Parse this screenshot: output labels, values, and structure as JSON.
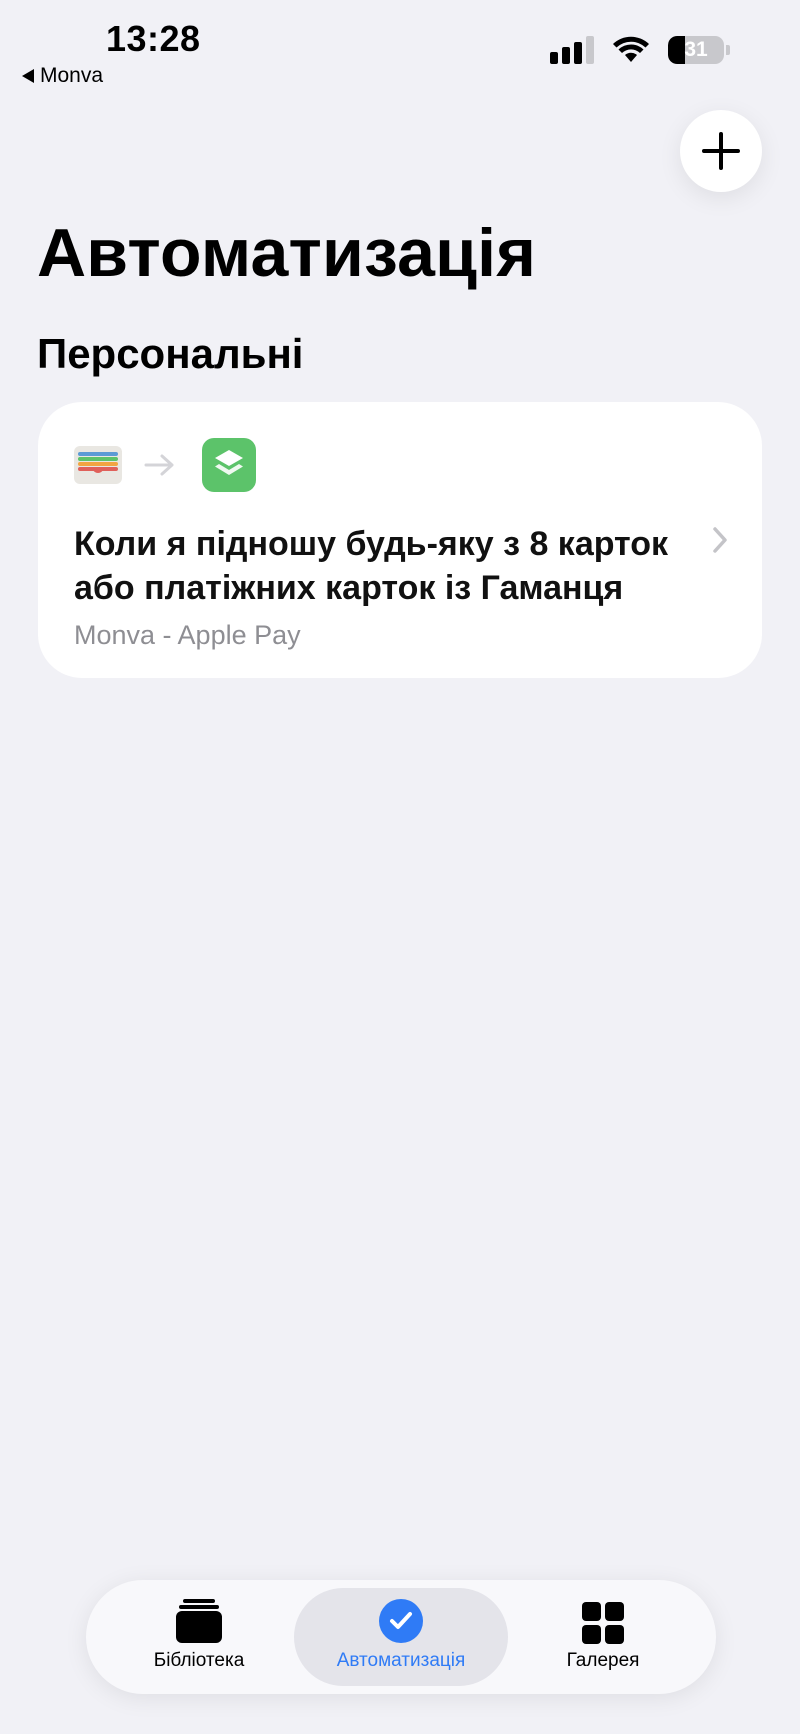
{
  "status_bar": {
    "time": "13:28",
    "back_label": "Monva",
    "battery_level": "31",
    "battery_fraction": 0.31
  },
  "header": {
    "add_icon": "plus-icon"
  },
  "page": {
    "title": "Автоматизація",
    "section_title": "Персональні"
  },
  "automations": [
    {
      "trigger_icon": "wallet-icon",
      "action_icon": "shortcuts-icon",
      "title": "Коли я підношу будь-яку з 8 карток або платіжних карток із Гаманця",
      "subtitle": "Monva - Apple Pay"
    }
  ],
  "tab_bar": {
    "tabs": [
      {
        "label": "Бібліотека",
        "icon": "library-stack-icon",
        "active": false
      },
      {
        "label": "Автоматизація",
        "icon": "automation-clock-check-icon",
        "active": true
      },
      {
        "label": "Галерея",
        "icon": "gallery-grid-icon",
        "active": false
      }
    ]
  },
  "colors": {
    "background": "#f1f1f6",
    "accent": "#2f7bf6",
    "shortcuts_green": "#5cc36a",
    "secondary_text": "#8e8e93"
  }
}
